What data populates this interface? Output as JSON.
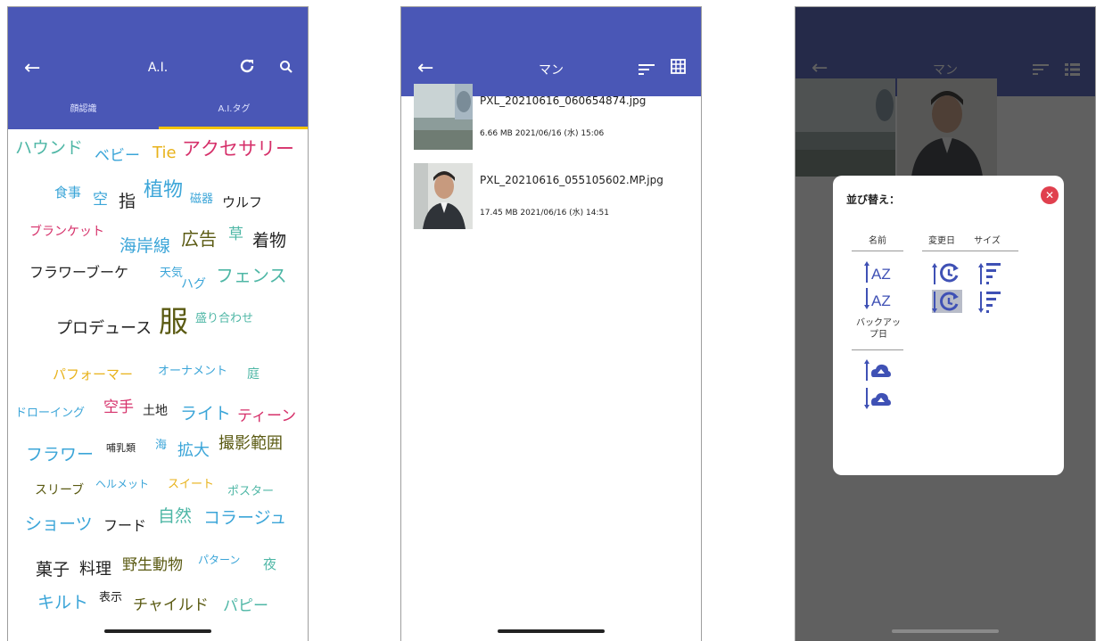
{
  "colors": {
    "appbar": "#4a57b6",
    "tab_indicator": "#f5c400",
    "accent": "#3f51b5",
    "close": "#e0404e"
  },
  "screen1": {
    "title": "A.I.",
    "back_icon": "arrow-left-icon",
    "refresh_icon": "refresh-icon",
    "search_icon": "search-icon",
    "tabs": [
      "顔認識",
      "A.I.タグ"
    ],
    "selected_tab": 1,
    "tags": [
      {
        "text": "ハウンド",
        "color": "#4fb7a6"
      },
      {
        "text": "ベビー",
        "color": "#3ba5d8"
      },
      {
        "text": "Tie",
        "color": "#e8b21a"
      },
      {
        "text": "アクセサリー",
        "color": "#d6306a"
      },
      {
        "text": "食事",
        "color": "#3ba5d8"
      },
      {
        "text": "空",
        "color": "#3ba5d8"
      },
      {
        "text": "指",
        "color": "#222222"
      },
      {
        "text": "植物",
        "color": "#3ba5d8"
      },
      {
        "text": "磁器",
        "color": "#3ba5d8"
      },
      {
        "text": "ウルフ",
        "color": "#222222"
      },
      {
        "text": "ブランケット",
        "color": "#d6306a"
      },
      {
        "text": "海岸線",
        "color": "#3ba5d8"
      },
      {
        "text": "広告",
        "color": "#5a5a12"
      },
      {
        "text": "草",
        "color": "#4fb7a6"
      },
      {
        "text": "着物",
        "color": "#222222"
      },
      {
        "text": "フラワーブーケ",
        "color": "#222222"
      },
      {
        "text": "天気",
        "color": "#3ba5d8"
      },
      {
        "text": "ハグ",
        "color": "#3ba5d8"
      },
      {
        "text": "フェンス",
        "color": "#4fb7a6"
      },
      {
        "text": "プロデュース",
        "color": "#222222"
      },
      {
        "text": "服",
        "color": "#5a5a12"
      },
      {
        "text": "盛り合わせ",
        "color": "#4fb7a6"
      },
      {
        "text": "パフォーマー",
        "color": "#e8b21a"
      },
      {
        "text": "オーナメント",
        "color": "#3ba5d8"
      },
      {
        "text": "庭",
        "color": "#4fb7a6"
      },
      {
        "text": "ドローイング",
        "color": "#3ba5d8"
      },
      {
        "text": "空手",
        "color": "#d6306a"
      },
      {
        "text": "土地",
        "color": "#222222"
      },
      {
        "text": "ライト",
        "color": "#3ba5d8"
      },
      {
        "text": "ティーン",
        "color": "#d6306a"
      },
      {
        "text": "フラワー",
        "color": "#3ba5d8"
      },
      {
        "text": "哺乳類",
        "color": "#222222"
      },
      {
        "text": "海",
        "color": "#3ba5d8"
      },
      {
        "text": "拡大",
        "color": "#3ba5d8"
      },
      {
        "text": "撮影範囲",
        "color": "#5a5a12"
      },
      {
        "text": "スリーブ",
        "color": "#5a5a12"
      },
      {
        "text": "ヘルメット",
        "color": "#3ba5d8"
      },
      {
        "text": "スイート",
        "color": "#e8b21a"
      },
      {
        "text": "ポスター",
        "color": "#4fb7a6"
      },
      {
        "text": "ショーツ",
        "color": "#3ba5d8"
      },
      {
        "text": "フード",
        "color": "#222222"
      },
      {
        "text": "自然",
        "color": "#4fb7a6"
      },
      {
        "text": "コラージュ",
        "color": "#3ba5d8"
      },
      {
        "text": "菓子",
        "color": "#222222"
      },
      {
        "text": "料理",
        "color": "#222222"
      },
      {
        "text": "野生動物",
        "color": "#5a5a12"
      },
      {
        "text": "パターン",
        "color": "#3ba5d8"
      },
      {
        "text": "夜",
        "color": "#4fb7a6"
      },
      {
        "text": "キルト",
        "color": "#3ba5d8"
      },
      {
        "text": "表示",
        "color": "#222222"
      },
      {
        "text": "チャイルド",
        "color": "#5a5a12"
      },
      {
        "text": "パピー",
        "color": "#4fb7a6"
      }
    ]
  },
  "screen2": {
    "title": "マン",
    "back_icon": "arrow-left-icon",
    "sort_icon": "sort-icon",
    "grid_icon": "grid-icon",
    "files": [
      {
        "name": "PXL_20210616_060654874.jpg",
        "meta": "6.66 MB 2021/06/16 (水) 15:06"
      },
      {
        "name": "PXL_20210616_055105602.MP.jpg",
        "meta": "17.45 MB 2021/06/16 (水) 14:51"
      }
    ]
  },
  "screen3": {
    "title": "マン",
    "dialog": {
      "title": "並び替え：",
      "columns": [
        "名前",
        "変更日",
        "サイズ"
      ],
      "backup_label": "バックアップ日",
      "selected": "modified-desc"
    }
  }
}
